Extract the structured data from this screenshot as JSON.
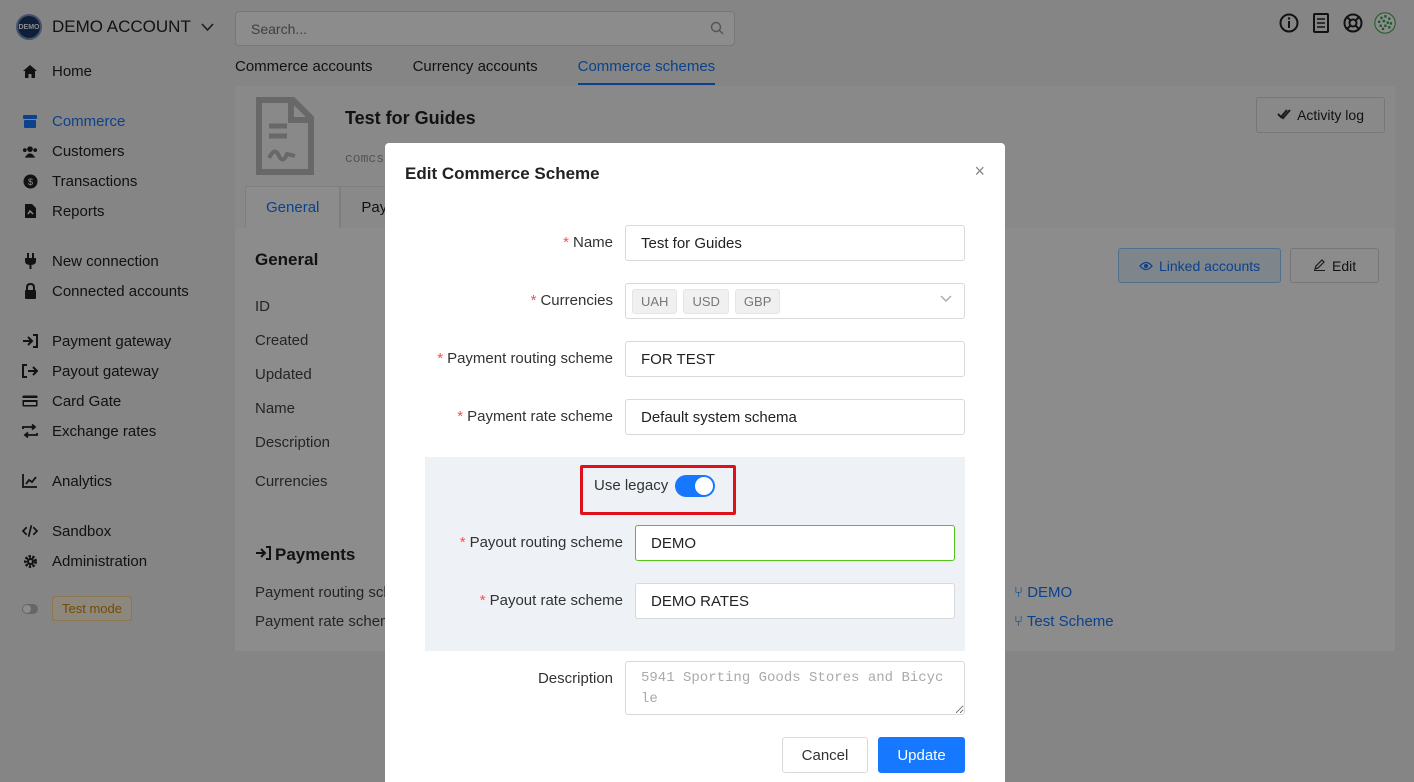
{
  "account": {
    "avatar_text": "DEMO",
    "name": "DEMO ACCOUNT"
  },
  "search": {
    "placeholder": "Search..."
  },
  "sidebar": {
    "items": [
      {
        "label": "Home",
        "icon": "home-icon"
      },
      {
        "label": "Commerce",
        "icon": "store-icon",
        "active": true
      },
      {
        "label": "Customers",
        "icon": "users-icon"
      },
      {
        "label": "Transactions",
        "icon": "coin-icon"
      },
      {
        "label": "Reports",
        "icon": "report-icon"
      },
      {
        "label": "New connection",
        "icon": "plug-icon"
      },
      {
        "label": "Connected accounts",
        "icon": "lock-icon"
      },
      {
        "label": "Payment gateway",
        "icon": "sign-in-icon"
      },
      {
        "label": "Payout gateway",
        "icon": "sign-out-icon"
      },
      {
        "label": "Card Gate",
        "icon": "card-icon"
      },
      {
        "label": "Exchange rates",
        "icon": "exchange-icon"
      },
      {
        "label": "Analytics",
        "icon": "chart-icon"
      },
      {
        "label": "Sandbox",
        "icon": "code-icon"
      },
      {
        "label": "Administration",
        "icon": "gear-icon"
      }
    ],
    "test_mode": "Test mode"
  },
  "top_tabs": [
    "Commerce accounts",
    "Currency accounts",
    "Commerce schemes"
  ],
  "scheme": {
    "title": "Test for Guides",
    "sub": "comcs",
    "activity_log": "Activity log",
    "tabs": [
      "General",
      "Payn"
    ],
    "general_title": "General",
    "fields": [
      "ID",
      "Created",
      "Updated",
      "Name",
      "Description",
      "Currencies"
    ],
    "linked_accounts": "Linked accounts",
    "edit": "Edit",
    "payments_title": "Payments",
    "payments_fields": [
      "Payment routing sch",
      "Payment rate schem"
    ],
    "payments_values": [
      "DEMO",
      "Test Scheme"
    ]
  },
  "modal": {
    "title": "Edit Commerce Scheme",
    "close": "×",
    "name_label": "Name",
    "name_value": "Test for Guides",
    "currencies_label": "Currencies",
    "currencies": [
      "UAH",
      "USD",
      "GBP"
    ],
    "routing_label": "Payment routing scheme",
    "routing_value": "FOR TEST",
    "rate_label": "Payment rate scheme",
    "rate_value": "Default system schema",
    "legacy_label": "Use legacy",
    "legacy_on": true,
    "payout_routing_label": "Payout routing scheme",
    "payout_routing_value": "DEMO",
    "payout_rate_label": "Payout rate scheme",
    "payout_rate_value": "DEMO RATES",
    "description_label": "Description",
    "description_placeholder": "5941 Sporting Goods Stores and Bicycle",
    "cancel": "Cancel",
    "update": "Update"
  }
}
